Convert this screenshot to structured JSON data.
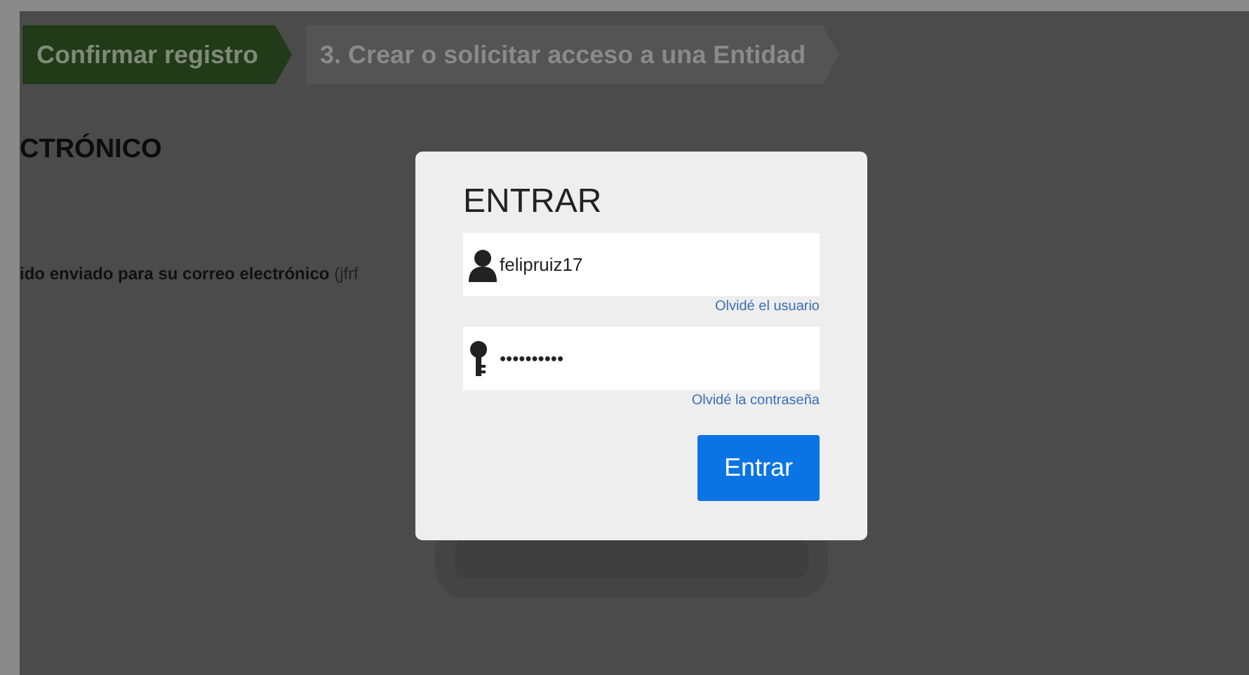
{
  "steps": [
    {
      "label": "Confirmar registro",
      "selected": true
    },
    {
      "label": "3. Crear o solicitar acceso a una Entidad",
      "selected": false
    }
  ],
  "heading": "CTRÓNICO",
  "message": "**ido enviado para su correo electrónico** (jfrf",
  "login_dialog": {
    "title": "ENTRAR",
    "username": {
      "value": "felipruiz17"
    },
    "forgot_username": "Olvidé el usuario",
    "password": {
      "value": "••••••••••"
    },
    "forgot_password": "Olvidé la contraseña",
    "submit": "Entrar"
  }
}
